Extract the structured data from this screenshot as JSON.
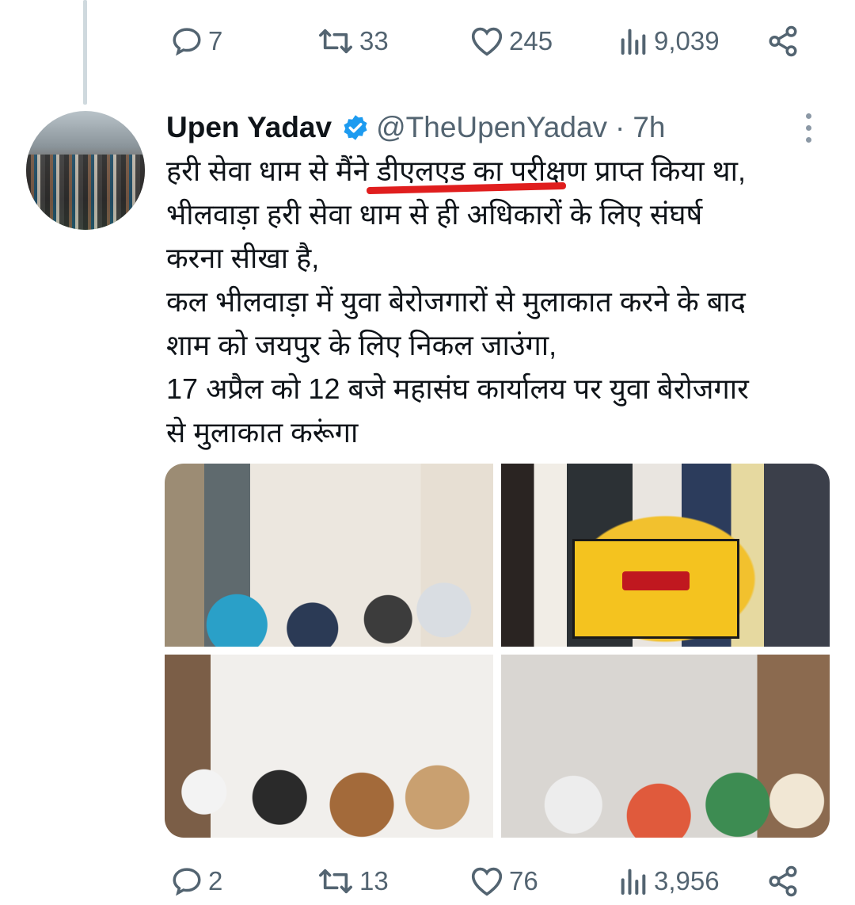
{
  "previous_tweet": {
    "actions": {
      "replies": "7",
      "retweets": "33",
      "likes": "245",
      "views": "9,039"
    }
  },
  "tweet": {
    "author_name": "Upen Yadav",
    "handle": "@TheUpenYadav",
    "separator": "·",
    "time": "7h",
    "lines": [
      "हरी सेवा धाम से मैंने डीएलएड का परीक्षण प्राप्त किया था,",
      "भीलवाड़ा हरी सेवा धाम से ही अधिकारों के लिए संघर्ष",
      "करना सीखा है,",
      "कल भीलवाड़ा में युवा बेरोजगारों से मुलाकात करने के बाद",
      "शाम को जयपुर के लिए निकल जाउंगा,",
      "17 अप्रैल को 12 बजे महासंघ कार्यालय पर युवा बेरोजगार",
      "से मुलाकात करूंगा"
    ],
    "actions": {
      "replies": "2",
      "retweets": "13",
      "likes": "76",
      "views": "3,956"
    },
    "verified_color": "#1d9bf0",
    "highlight_color": "#e01e1e"
  }
}
